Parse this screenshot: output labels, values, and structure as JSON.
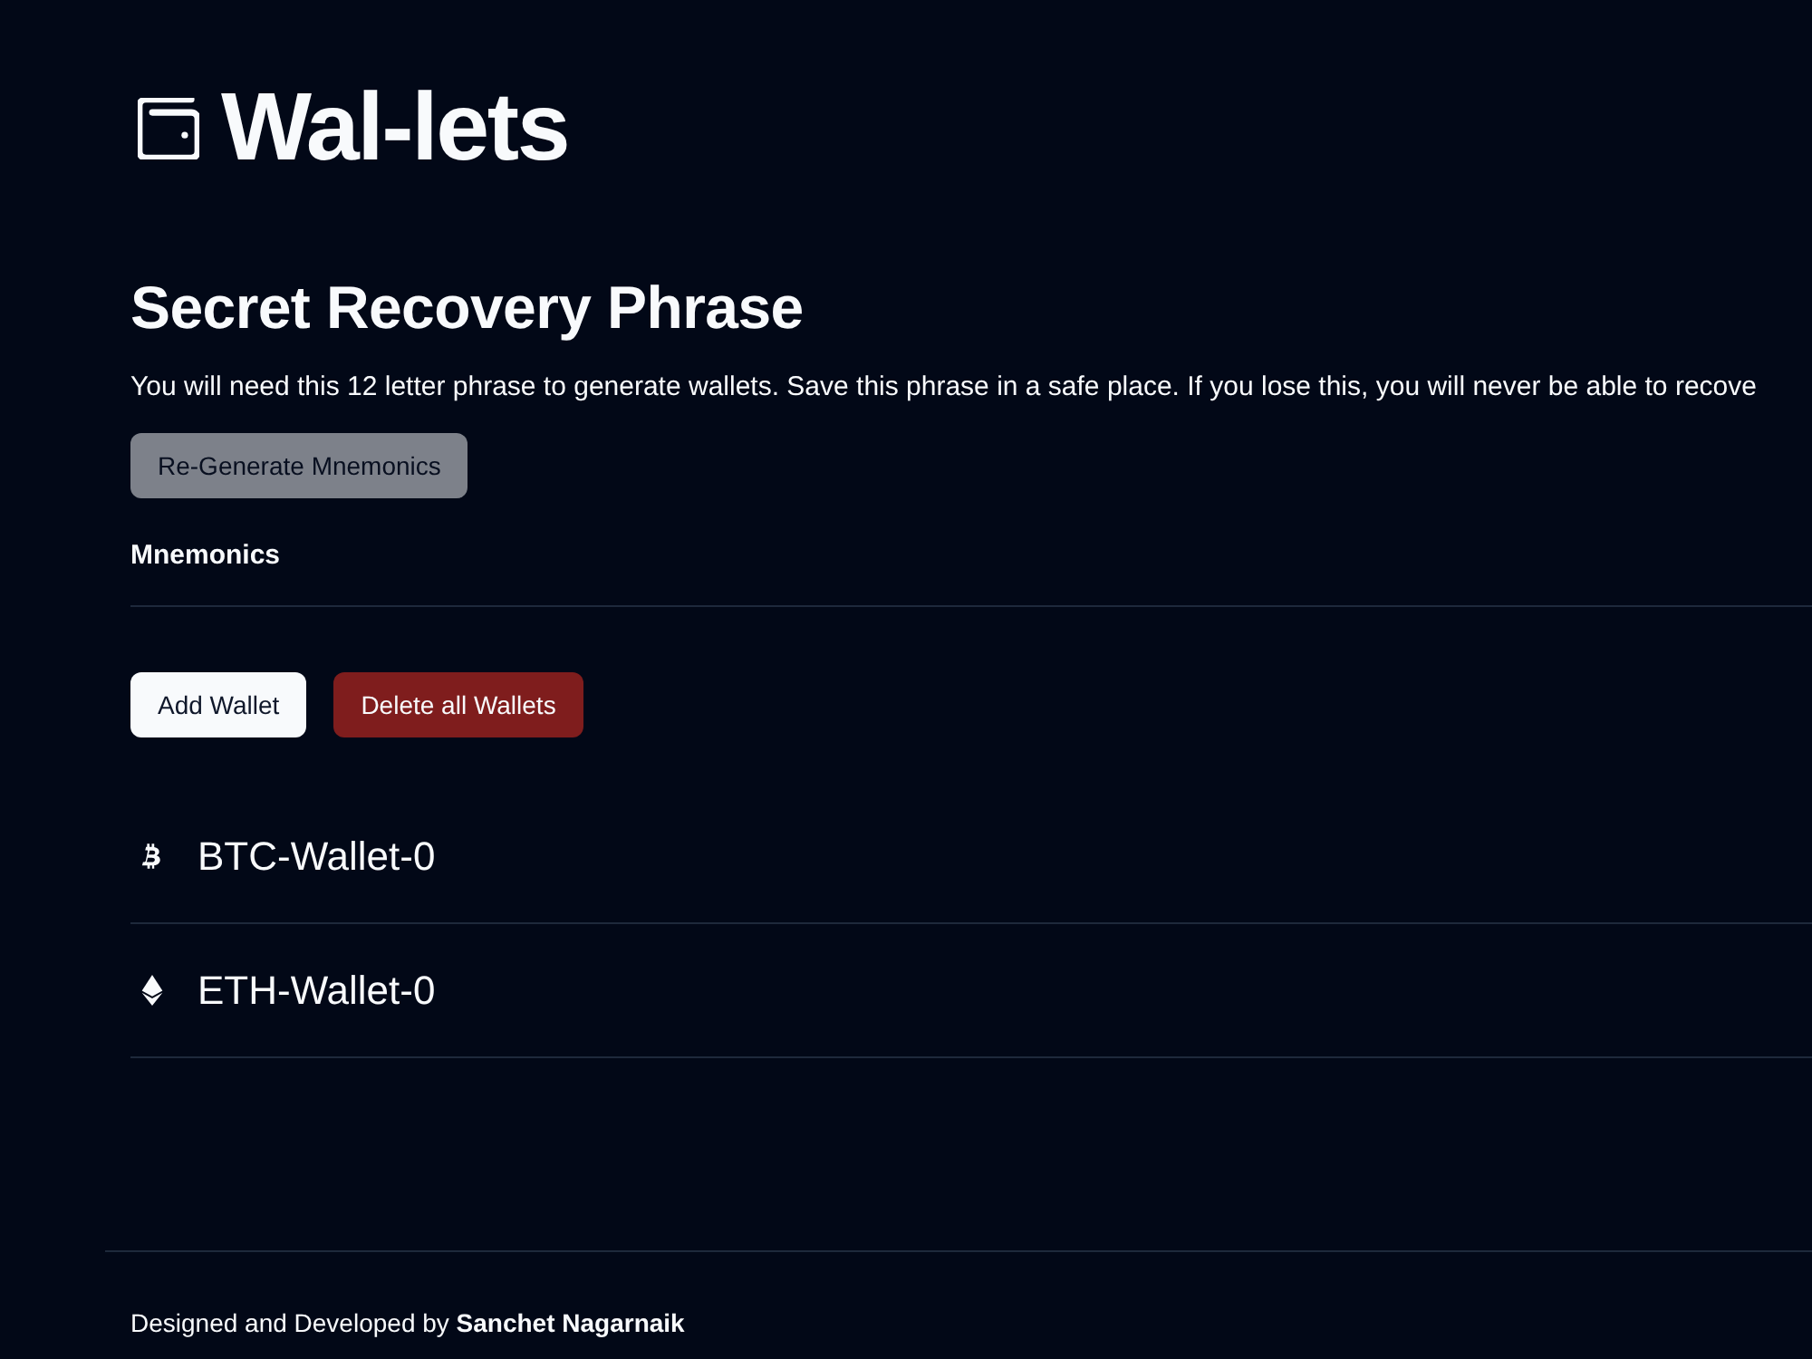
{
  "header": {
    "title": "Wal-lets"
  },
  "recovery": {
    "heading": "Secret Recovery Phrase",
    "description": "You will need this 12 letter phrase to generate wallets. Save this phrase in a safe place. If you lose this, you will never be able to recove",
    "regenerate_button": {
      "label": "Re-Generate Mnemonics",
      "disabled": true
    },
    "mnemonics_label": "Mnemonics"
  },
  "actions": [
    {
      "label": "Add Wallet",
      "kind": "primary"
    },
    {
      "label": "Delete all Wallets",
      "kind": "danger"
    }
  ],
  "wallets": [
    {
      "kind": "bitcoin",
      "name": "BTC-Wallet-0"
    },
    {
      "kind": "ethereum",
      "name": "ETH-Wallet-0"
    }
  ],
  "footer": {
    "credit": "Designed and Developed by **Sanchet Nagarnaik**"
  }
}
